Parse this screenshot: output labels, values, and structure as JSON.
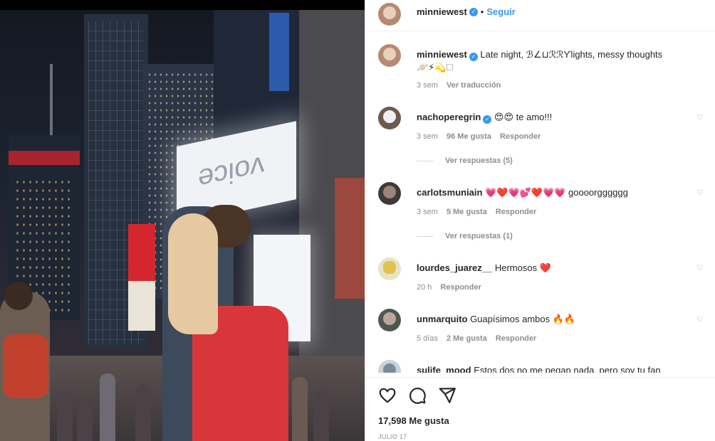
{
  "post": {
    "author": "minniewest",
    "follow_label": "Seguir",
    "separator": "•"
  },
  "caption": {
    "username": "minniewest",
    "text": "Late night, ℬ∠⊔ℛℛϒlights, messy thoughts",
    "emojis": "🪐⚡💫🗆",
    "time": "3 sem",
    "translate": "Ver traducción"
  },
  "photo_sign_text": "voice",
  "comments": [
    {
      "username": "nachoperegrin",
      "verified": true,
      "text": "😍😍 te amo!!!",
      "time": "3 sem",
      "likes": "96 Me gusta",
      "reply": "Responder",
      "view_replies": "Ver respuestas (5)"
    },
    {
      "username": "carlotsmuniain",
      "verified": false,
      "text": "💗❤️💗💕❤️💗💗 goooorgggggg",
      "time": "3 sem",
      "likes": "5 Me gusta",
      "reply": "Responder",
      "view_replies": "Ver respuestas (1)"
    },
    {
      "username": "lourdes_juarez__",
      "verified": false,
      "text": "Hermosos ❤️",
      "time": "20 h",
      "likes": "",
      "reply": "Responder"
    },
    {
      "username": "unmarquito",
      "verified": false,
      "text": "Guapísimos ambos 🔥🔥",
      "time": "5 días",
      "likes": "2 Me gusta",
      "reply": "Responder"
    },
    {
      "username": "sulife_mood",
      "verified": false,
      "text": "Estos dos no me pegan nada, pero soy tu fan"
    }
  ],
  "footer": {
    "likes": "17,598 Me gusta",
    "date": "JULIO 17"
  },
  "colors": {
    "link_blue": "#3897f0",
    "muted": "#8e8e8e",
    "text": "#262626"
  },
  "icons": [
    "heart-icon",
    "comment-icon",
    "share-icon",
    "verified-icon"
  ]
}
